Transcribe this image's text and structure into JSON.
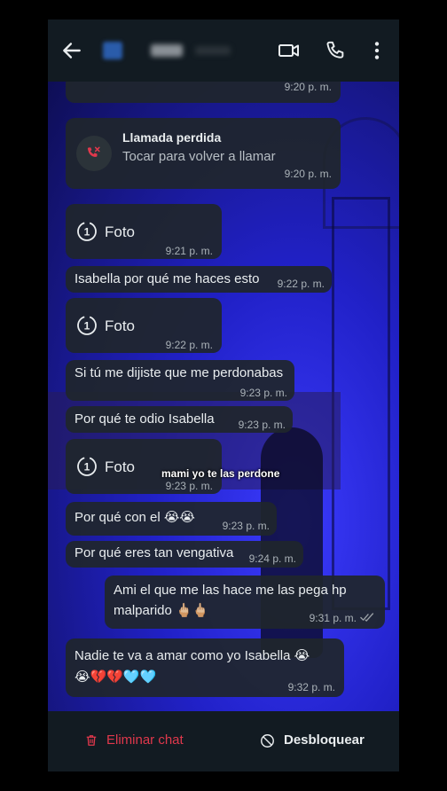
{
  "colors": {
    "header_bg": "#121b22",
    "bubble_bg": "#1f262c",
    "danger": "#e0384c",
    "read_ticks": "#9aa0a6"
  },
  "header": {
    "back_icon": "arrow-left-icon",
    "video_icon": "video-call-icon",
    "call_icon": "phone-icon",
    "menu_icon": "more-vert-icon"
  },
  "messages": {
    "m0": {
      "time": "9:20 p. m."
    },
    "m1": {
      "title": "Llamada perdida",
      "subtitle": "Tocar para volver a llamar",
      "time": "9:20 p. m.",
      "icon": "missed-call-icon"
    },
    "m2": {
      "label": "Foto",
      "time": "9:21 p. m.",
      "icon": "view-once-icon"
    },
    "m3": {
      "text": "Isabella por qué me haces esto",
      "time": "9:22 p. m."
    },
    "m4": {
      "label": "Foto",
      "time": "9:22 p. m.",
      "icon": "view-once-icon"
    },
    "m5": {
      "text": "Si tú me dijiste que me perdonabas",
      "time": "9:23 p. m."
    },
    "m6": {
      "text": "Por qué te odio Isabella",
      "time": "9:23 p. m."
    },
    "m7": {
      "label": "Foto",
      "time": "9:23 p. m.",
      "icon": "view-once-icon"
    },
    "m8": {
      "text": "Por qué con el 😭😭",
      "time": "9:23 p. m."
    },
    "m9": {
      "text": "Por qué eres tan vengativa",
      "time": "9:24 p. m."
    },
    "m10": {
      "line1": "Ami el que me las hace me las pega hp",
      "line2": "malparido 🖕🏼🖕🏼",
      "time": "9:31 p. m."
    },
    "m11": {
      "line1": "Nadie te va a amar como yo Isabella 😭",
      "line2": "😭💔💔🩵🩵",
      "time": "9:32 p. m."
    }
  },
  "overlay_caption": "mami yo te las perdone",
  "footer": {
    "delete_label": "Eliminar chat",
    "unblock_label": "Desbloquear"
  }
}
